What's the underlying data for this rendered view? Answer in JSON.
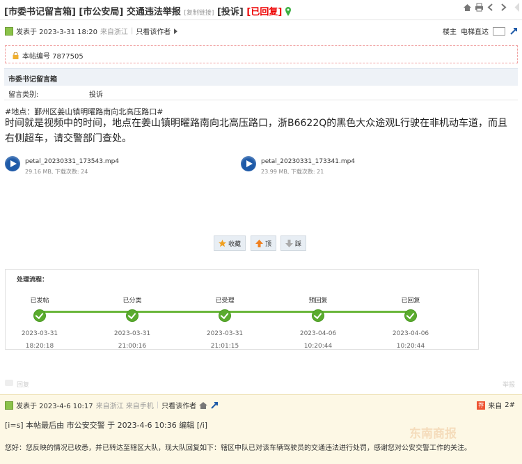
{
  "header": {
    "title_part1": "[市委书记留言箱]",
    "title_part2": "[市公安局]",
    "title_part3": "交通违法举报",
    "copy_link": "[复制链接]",
    "tag_complain": "[投诉]",
    "tag_replied": "[已回复]"
  },
  "post_meta": {
    "posted_at": "发表于 2023-3-31 18:20",
    "from": "来自浙江",
    "only_author": "只看该作者",
    "floor": "楼主",
    "jump": "电梯直达"
  },
  "post_number": "本帖编号 7877505",
  "section": {
    "title": "市委书记留言箱",
    "category_label": "留言类别:",
    "category_value": "投诉"
  },
  "content": {
    "location": "#地点：鄞州区姜山镇明曜路南向北高压路口#",
    "body": "时间就是视频中的时间，地点在姜山镇明曜路南向北高压路口，浙B6622Q的黑色大众途观L行驶在非机动车道，而且右侧超车，请交警部门查处。"
  },
  "attachments": [
    {
      "name": "petal_20230331_173543.mp4",
      "meta": "29.16 MB, 下载次数: 24"
    },
    {
      "name": "petal_20230331_173341.mp4",
      "meta": "23.99 MB, 下载次数: 21"
    }
  ],
  "actions": {
    "favorite": "收藏",
    "up": "顶",
    "down": "踩"
  },
  "flow": {
    "title": "处理流程：",
    "steps": [
      {
        "name": "已发帖",
        "date": "2023-03-31",
        "time": "18:20:18"
      },
      {
        "name": "已分类",
        "date": "2023-03-31",
        "time": "21:00:16"
      },
      {
        "name": "已受理",
        "date": "2023-03-31",
        "time": "21:01:15"
      },
      {
        "name": "预回复",
        "date": "2023-04-06",
        "time": "10:20:44"
      },
      {
        "name": "已回复",
        "date": "2023-04-06",
        "time": "10:20:44"
      }
    ]
  },
  "reply_bar": {
    "reply": "回复",
    "report": "举报"
  },
  "second_post": {
    "posted_at": "发表于 2023-4-6 10:17",
    "from": "来自浙江 来自手机",
    "only_author": "只看该作者",
    "from_short": "来自",
    "floor": "2#",
    "edit_note": "[i=s] 本帖最后由 市公安交警 于 2023-4-6 10:36 编辑 [/i]",
    "reply_text": "您好：您反映的情况已收悉，并已转达至辖区大队，现大队回复如下：辖区中队已对该车辆驾驶员的交通违法进行处罚，感谢您对公安交警工作的关注。",
    "watermark": "东南商报"
  },
  "colors": {
    "accent_red": "#ee0000",
    "flow_green": "#5aab2e",
    "header_bg": "#eef2f7",
    "second_post_bg": "#fdf8e5"
  }
}
